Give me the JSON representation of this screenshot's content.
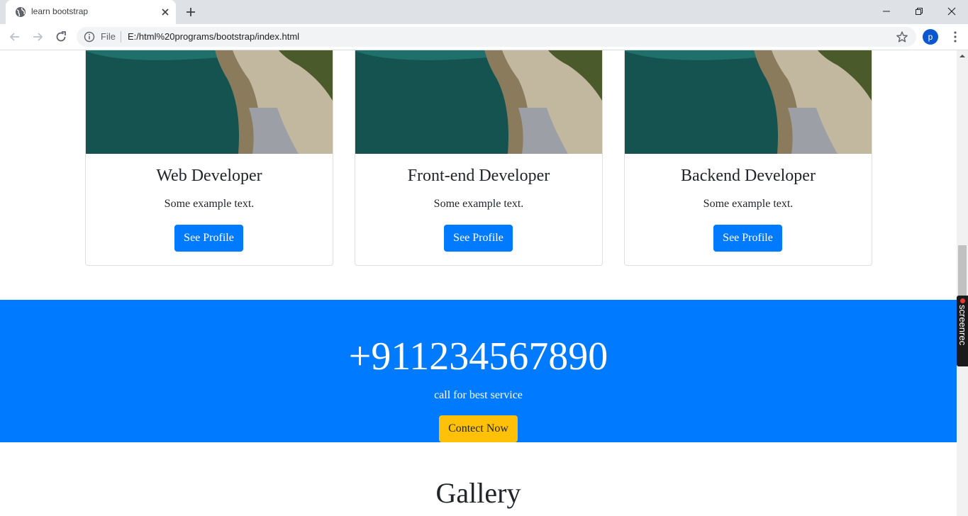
{
  "browser": {
    "tab_title": "learn bootstrap",
    "scheme_label": "File",
    "url": "E:/html%20programs/bootstrap/index.html",
    "profile_initial": "p"
  },
  "cards": [
    {
      "title": "Web Developer",
      "text": "Some example text.",
      "button_label": "See Profile"
    },
    {
      "title": "Front-end Developer",
      "text": "Some example text.",
      "button_label": "See Profile"
    },
    {
      "title": "Backend Developer",
      "text": "Some example text.",
      "button_label": "See Profile"
    }
  ],
  "cta": {
    "phone": "+911234567890",
    "subtitle": "call for best service",
    "button_label": "Contect Now"
  },
  "gallery": {
    "heading": "Gallery"
  },
  "overlay": {
    "recorder_label": "screenrec"
  },
  "colors": {
    "primary": "#007bff",
    "warning": "#ffc107",
    "tabbar": "#dee1e6",
    "avatar": "#0b57d0"
  },
  "icons": [
    "globe-icon",
    "close-icon",
    "plus-icon",
    "minimize-icon",
    "restore-icon",
    "back-arrow-icon",
    "forward-arrow-icon",
    "reload-icon",
    "info-icon",
    "star-icon",
    "kebab-menu-icon"
  ]
}
